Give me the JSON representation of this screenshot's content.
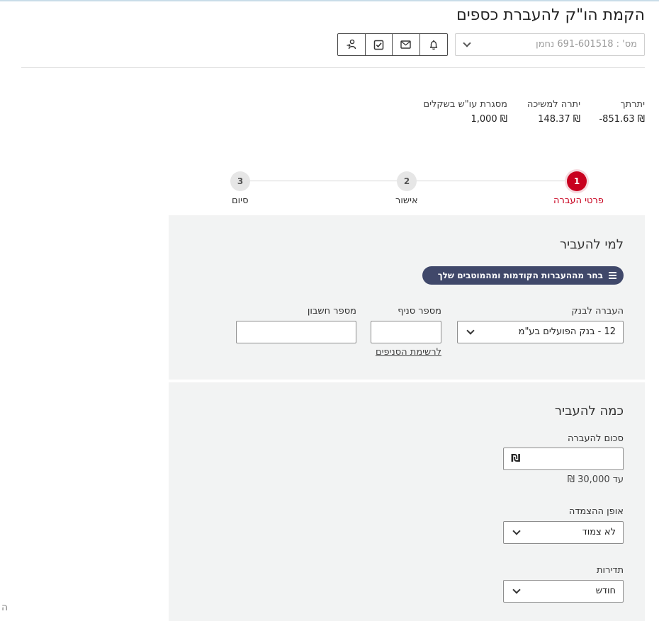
{
  "page": {
    "title": "הקמת הו\"ק להעברת כספים"
  },
  "account": {
    "selected": "מס' : 691-601518 נחמן"
  },
  "toolbar": {
    "icons": [
      "bell-icon",
      "mail-icon",
      "checkbox-icon",
      "user-transfer-icon"
    ]
  },
  "balances": [
    {
      "label": "יתרתך",
      "value": "₪ 851.63-"
    },
    {
      "label": "יתרה למשיכה",
      "value": "₪ 148.37"
    },
    {
      "label": "מסגרת עו\"ש בשקלים",
      "value": "₪ 1,000"
    }
  ],
  "steps": [
    {
      "number": "1",
      "label": "פרטי העברה",
      "active": true
    },
    {
      "number": "2",
      "label": "אישור",
      "active": false
    },
    {
      "number": "3",
      "label": "סיום",
      "active": false
    }
  ],
  "recipient": {
    "title": "למי להעביר",
    "choose_button": "בחר מההעברות הקודמות ומהמוטבים שלך",
    "bank_label": "העברה לבנק",
    "bank_value": "12 - בנק הפועלים בע\"מ",
    "branch_label": "מספר סניף",
    "branch_value": "",
    "account_label": "מספר חשבון",
    "account_value": "",
    "branches_link": "לרשימת הסניפים"
  },
  "amount": {
    "title": "כמה להעביר",
    "amount_label": "סכום להעברה",
    "currency_symbol": "₪",
    "amount_value": "",
    "limit_hint": "עד 30,000 ₪",
    "indexation_label": "אופן ההצמדה",
    "indexation_value": "לא צמוד",
    "frequency_label": "תדירות",
    "frequency_value": "חודש"
  },
  "footer": {
    "corner_char": "ה"
  },
  "colors": {
    "accent": "#c8001e",
    "pill": "#40486a",
    "panel": "#f2f3f3"
  }
}
